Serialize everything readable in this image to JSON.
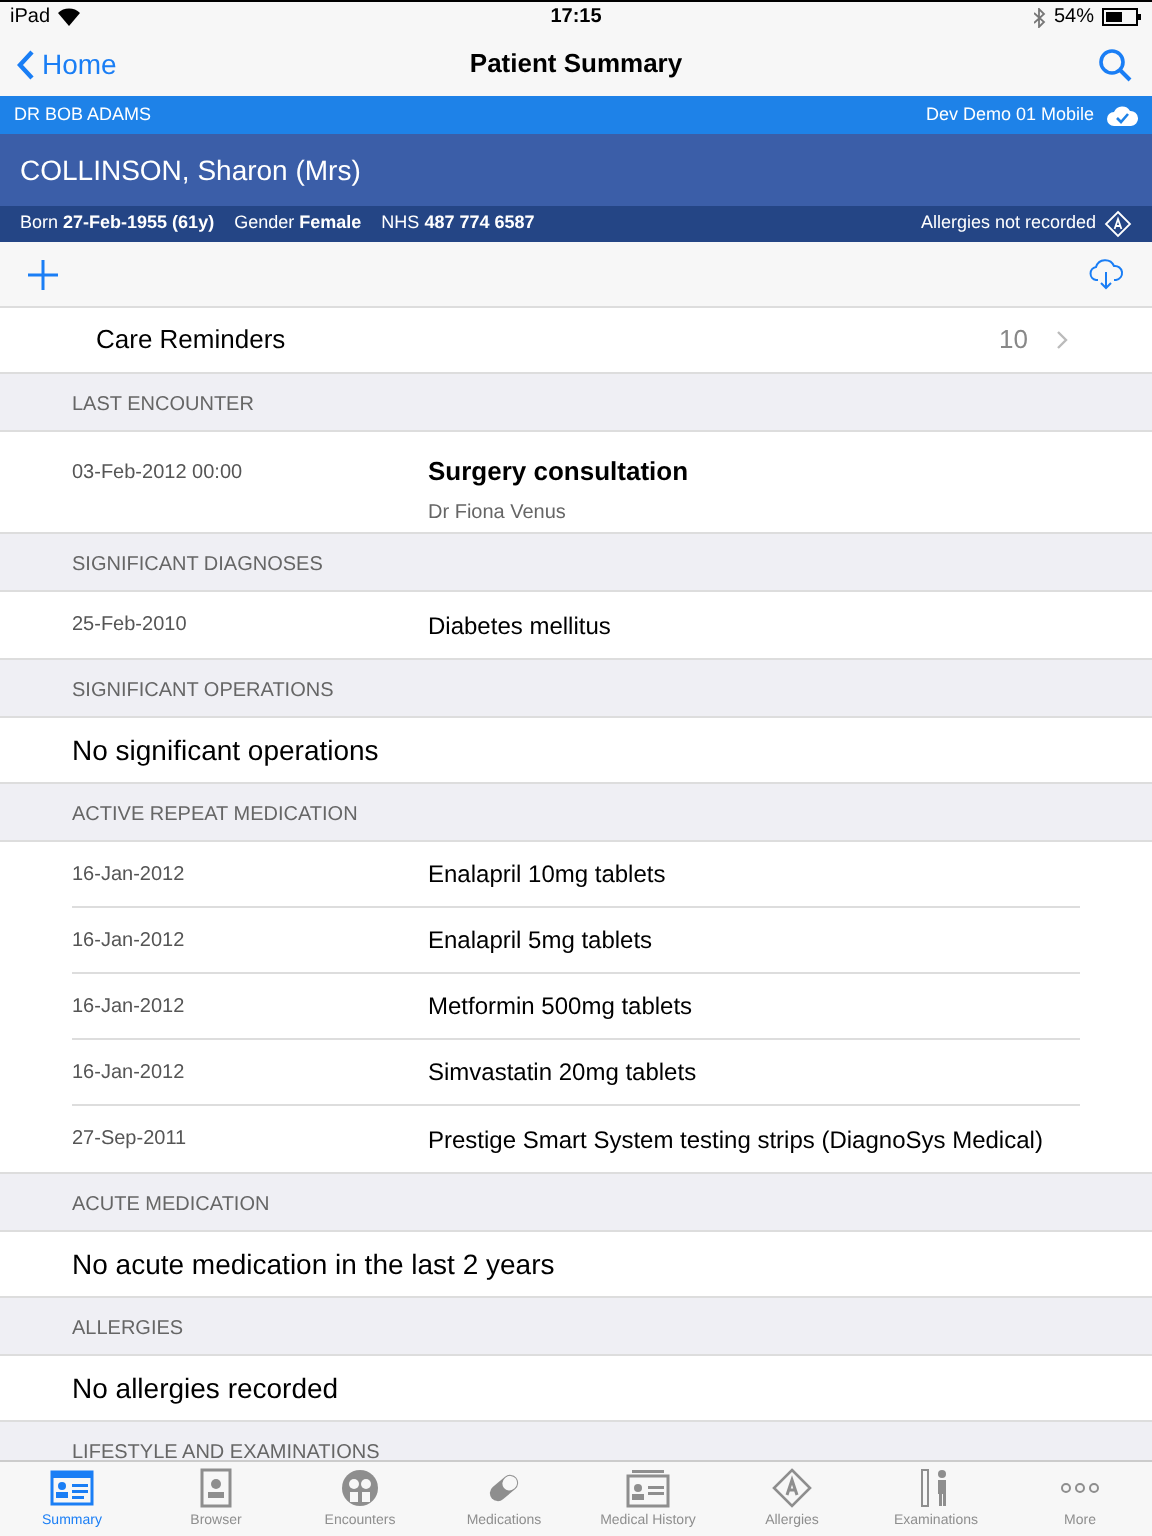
{
  "status_bar": {
    "device": "iPad",
    "time": "17:15",
    "battery": "54%"
  },
  "nav": {
    "back": "Home",
    "title": "Patient Summary"
  },
  "user_bar": {
    "clinician": "DR BOB ADAMS",
    "device_name": "Dev Demo 01 Mobile"
  },
  "patient": {
    "name": "COLLINSON, Sharon (Mrs)",
    "born_label": "Born",
    "born": "27-Feb-1955 (61y)",
    "gender_label": "Gender",
    "gender": "Female",
    "nhs_label": "NHS",
    "nhs": "487 774 6587",
    "allergies": "Allergies not recorded"
  },
  "care_reminders": {
    "label": "Care Reminders",
    "count": "10"
  },
  "sections": [
    {
      "title": "LAST ENCOUNTER",
      "rows": [
        {
          "kind": "encounter",
          "date": "03-Feb-2012 00:00",
          "title": "Surgery consultation",
          "subtitle": "Dr Fiona Venus"
        }
      ]
    },
    {
      "title": "SIGNIFICANT DIAGNOSES",
      "rows": [
        {
          "kind": "entry",
          "date": "25-Feb-2010",
          "title": "Diabetes mellitus"
        }
      ]
    },
    {
      "title": "SIGNIFICANT OPERATIONS",
      "rows": [
        {
          "kind": "message",
          "title": "No significant operations"
        }
      ]
    },
    {
      "title": "ACTIVE REPEAT MEDICATION",
      "rows": [
        {
          "kind": "entry",
          "date": "16-Jan-2012",
          "title": "Enalapril 10mg tablets"
        },
        {
          "kind": "entry",
          "date": "16-Jan-2012",
          "title": "Enalapril 5mg tablets"
        },
        {
          "kind": "entry",
          "date": "16-Jan-2012",
          "title": "Metformin 500mg tablets"
        },
        {
          "kind": "entry",
          "date": "16-Jan-2012",
          "title": "Simvastatin 20mg tablets"
        },
        {
          "kind": "entry",
          "date": "27-Sep-2011",
          "title": "Prestige Smart System testing strips (DiagnoSys Medical)"
        }
      ]
    },
    {
      "title": "ACUTE MEDICATION",
      "rows": [
        {
          "kind": "message",
          "title": "No acute medication in the last 2 years"
        }
      ]
    },
    {
      "title": "ALLERGIES",
      "rows": [
        {
          "kind": "message",
          "title": "No allergies recorded"
        }
      ]
    },
    {
      "title": "LIFESTYLE AND EXAMINATIONS"
    }
  ],
  "tabs": [
    {
      "label": "Summary",
      "selected": true
    },
    {
      "label": "Browser",
      "selected": false
    },
    {
      "label": "Encounters",
      "selected": false
    },
    {
      "label": "Medications",
      "selected": false
    },
    {
      "label": "Medical History",
      "selected": false
    },
    {
      "label": "Allergies",
      "selected": false
    },
    {
      "label": "Examinations",
      "selected": false
    },
    {
      "label": "More",
      "selected": false
    }
  ]
}
